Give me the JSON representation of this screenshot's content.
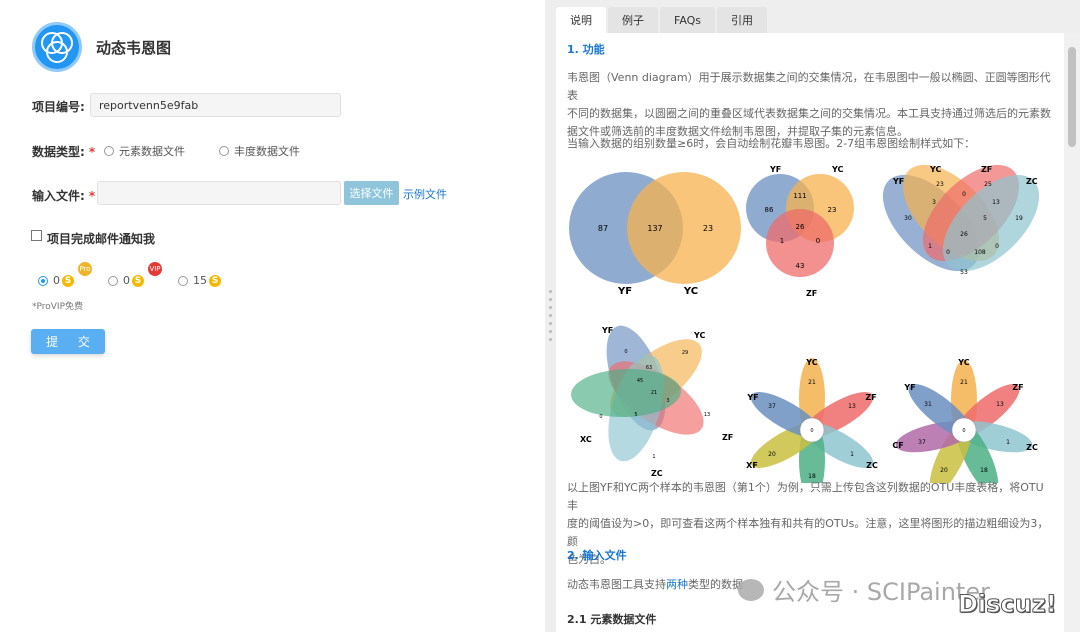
{
  "app": {
    "title": "动态韦恩图"
  },
  "form": {
    "project_label": "项目编号:",
    "project_value": "reportvenn5e9fab",
    "datatype_label": "数据类型:",
    "datatype_required": "*",
    "datatype_options": [
      "元素数据文件",
      "丰度数据文件"
    ],
    "file_label": "输入文件:",
    "file_required": "*",
    "choose_file_button": "选择文件",
    "example_file_link": "示例文件",
    "email_notify_label": "项目完成邮件通知我",
    "price_options": [
      {
        "value": "0",
        "badge": "Pro",
        "coin": "S"
      },
      {
        "value": "0",
        "badge": "VIP",
        "coin": "S"
      },
      {
        "value": "15",
        "coin": "S"
      }
    ],
    "provip_note": "*ProVIP免费",
    "submit_button": "提 交"
  },
  "tabs": [
    "说明",
    "例子",
    "FAQs",
    "引用"
  ],
  "doc": {
    "section1_title": "1. 功能",
    "para1_line1": "韦恩图（Venn diagram）用于展示数据集之间的交集情况，在韦恩图中一般以椭圆、正圆等图形代表",
    "para1_line2": "不同的数据集，以圆圈之间的重叠区域代表数据集之间的交集情况。本工具支持通过筛选后的元素数",
    "para1_line3": "据文件或筛选前的丰度数据文件绘制韦恩图，并提取子集的元素信息。",
    "para2": "当输入数据的组别数量≥6时，会自动绘制花瓣韦恩图。2-7组韦恩图绘制样式如下：",
    "para3_line1": "以上图YF和YC两个样本的韦恩图（第1个）为例，只需上传包含这列数据的OTU丰度表格，将OTU丰",
    "para3_line2": "度的阈值设为>0，即可查看这两个样本独有和共有的OTUs。注意，这里将图形的描边粗细设为3，颜",
    "para3_line3": "色为白。",
    "section2_title": "2. 输入文件",
    "para4_prefix": "动态韦恩图工具支持",
    "para4_highlight": "两种",
    "para4_suffix": "类型的数据",
    "sub21_title": "2.1  元素数据文件"
  },
  "venn": {
    "v2": {
      "labels": [
        "YF",
        "YC"
      ],
      "values": [
        "87",
        "137",
        "23"
      ]
    },
    "v3": {
      "labels": [
        "YF",
        "YC",
        "ZF"
      ],
      "values": [
        "86",
        "111",
        "23",
        "26",
        "1",
        "0",
        "43"
      ]
    },
    "v4": {
      "labels": [
        "YF",
        "YC",
        "ZF",
        "ZC"
      ],
      "values": [
        "30",
        "23",
        "25",
        "19",
        "3",
        "0",
        "13",
        "5",
        "26",
        "1",
        "0",
        "0",
        "108",
        "53"
      ]
    },
    "v5": {
      "labels": [
        "YF",
        "YC",
        "ZF",
        "ZC",
        "XC"
      ],
      "values": [
        "0",
        "29",
        "13",
        "1",
        "0",
        "63",
        "45",
        "21",
        "3",
        "5"
      ]
    },
    "v6": {
      "labels": [
        "YC",
        "ZF",
        "ZC",
        "XC",
        "XF",
        "YF"
      ],
      "values": [
        "21",
        "13",
        "1",
        "18",
        "20",
        "37"
      ],
      "center": "0"
    },
    "v7": {
      "labels": [
        "YC",
        "ZF",
        "ZC",
        "XC",
        "XF",
        "CF",
        "YF"
      ],
      "values": [
        "21",
        "13",
        "1",
        "18",
        "20",
        "37",
        "31"
      ],
      "center": "0"
    }
  },
  "watermark": {
    "text": "公众号 · SCIPainter",
    "discuz": "Discuz!"
  },
  "colors": {
    "accent": "#1976d2",
    "submit": "#5aaef2",
    "choose": "#8fc5da",
    "coin": "#f5b800",
    "pro": "#f0b429",
    "vip": "#e53935"
  }
}
